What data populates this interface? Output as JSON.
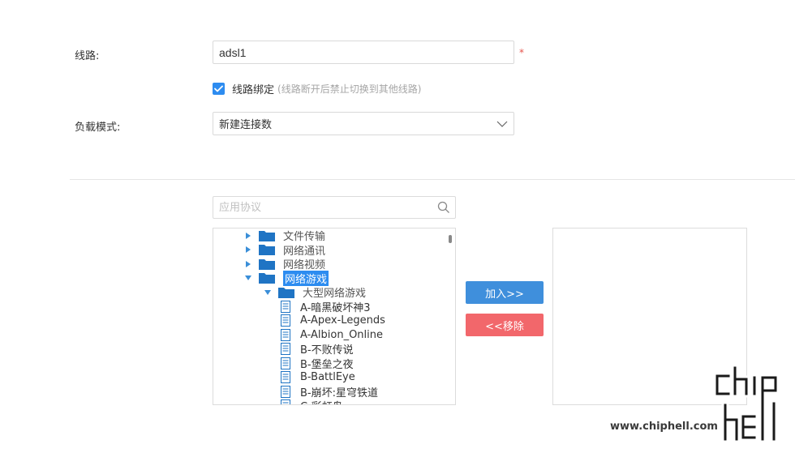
{
  "form": {
    "line_label": "线路:",
    "line_value": "adsl1",
    "required_mark": "*",
    "bind_label": "线路绑定",
    "bind_hint": "(线路断开后禁止切换到其他线路)",
    "bind_checked": true,
    "load_mode_label": "负载模式:",
    "load_mode_value": "新建连接数"
  },
  "search": {
    "placeholder": "应用协议"
  },
  "tree": {
    "folders": [
      {
        "label": "文件传输",
        "expanded": false
      },
      {
        "label": "网络通讯",
        "expanded": false
      },
      {
        "label": "网络视频",
        "expanded": false
      },
      {
        "label": "网络游戏",
        "expanded": true,
        "selected": true
      }
    ],
    "subfolder": "大型网络游戏",
    "leaves": [
      "A-暗黑破坏神3",
      "A-Apex-Legends",
      "A-Albion_Online",
      "B-不败传说",
      "B-堡垒之夜",
      "B-BattlEye",
      "B-崩坏:星穹铁道",
      "C-彩虹岛"
    ]
  },
  "buttons": {
    "add": "加入>>",
    "remove": "<<移除"
  },
  "colors": {
    "accent": "#2d8cf0",
    "add_button": "#3f8fdc",
    "remove_button": "#f2676b",
    "required": "#e5534b"
  },
  "watermark": {
    "url": "www.chiphell.com"
  }
}
